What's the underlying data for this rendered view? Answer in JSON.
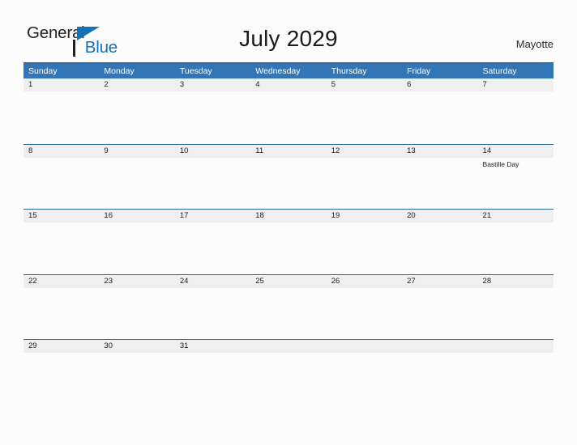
{
  "brand": {
    "name_part1": "General",
    "name_part2": "Blue",
    "logo_icon": "blue-triangle-logo"
  },
  "header": {
    "title": "July 2029",
    "region": "Mayotte"
  },
  "colors": {
    "header_blue": "#3176b6",
    "border_blue": "#2a69a3",
    "band_gray": "#efefef",
    "brand_blue": "#1271b8",
    "page_background": "#fcfcfd",
    "text_dark": "#1d1d1d"
  },
  "calendar": {
    "month": "July",
    "year": "2029",
    "weekdays": [
      "Sunday",
      "Monday",
      "Tuesday",
      "Wednesday",
      "Thursday",
      "Friday",
      "Saturday"
    ],
    "weeks": [
      [
        {
          "day": "1",
          "event": ""
        },
        {
          "day": "2",
          "event": ""
        },
        {
          "day": "3",
          "event": ""
        },
        {
          "day": "4",
          "event": ""
        },
        {
          "day": "5",
          "event": ""
        },
        {
          "day": "6",
          "event": ""
        },
        {
          "day": "7",
          "event": ""
        }
      ],
      [
        {
          "day": "8",
          "event": ""
        },
        {
          "day": "9",
          "event": ""
        },
        {
          "day": "10",
          "event": ""
        },
        {
          "day": "11",
          "event": ""
        },
        {
          "day": "12",
          "event": ""
        },
        {
          "day": "13",
          "event": ""
        },
        {
          "day": "14",
          "event": "Bastille Day"
        }
      ],
      [
        {
          "day": "15",
          "event": ""
        },
        {
          "day": "16",
          "event": ""
        },
        {
          "day": "17",
          "event": ""
        },
        {
          "day": "18",
          "event": ""
        },
        {
          "day": "19",
          "event": ""
        },
        {
          "day": "20",
          "event": ""
        },
        {
          "day": "21",
          "event": ""
        }
      ],
      [
        {
          "day": "22",
          "event": ""
        },
        {
          "day": "23",
          "event": ""
        },
        {
          "day": "24",
          "event": ""
        },
        {
          "day": "25",
          "event": ""
        },
        {
          "day": "26",
          "event": ""
        },
        {
          "day": "27",
          "event": ""
        },
        {
          "day": "28",
          "event": ""
        }
      ],
      [
        {
          "day": "29",
          "event": ""
        },
        {
          "day": "30",
          "event": ""
        },
        {
          "day": "31",
          "event": ""
        },
        {
          "day": "",
          "event": ""
        },
        {
          "day": "",
          "event": ""
        },
        {
          "day": "",
          "event": ""
        },
        {
          "day": "",
          "event": ""
        }
      ]
    ]
  }
}
